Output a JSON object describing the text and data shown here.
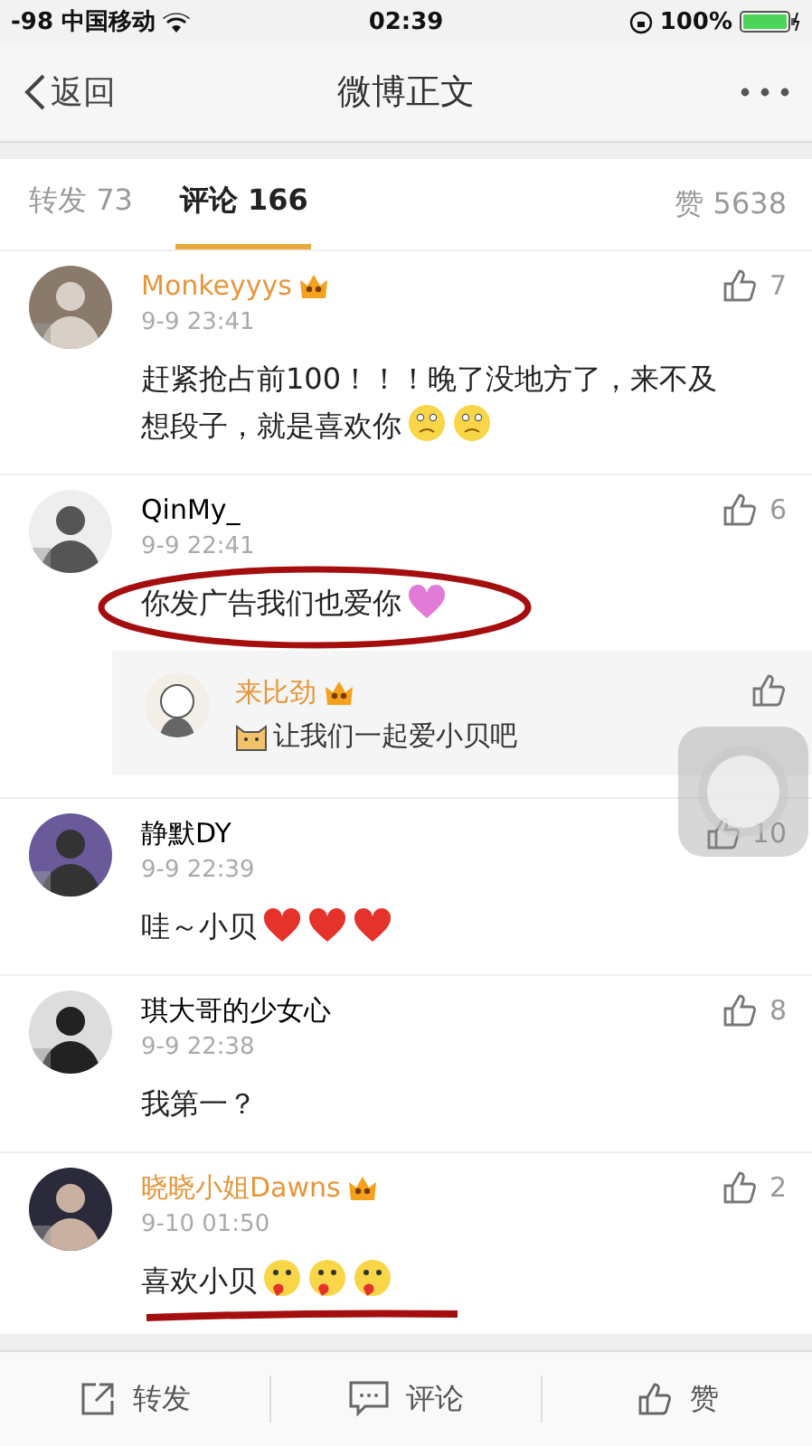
{
  "status_bar": {
    "carrier": "-98 中国移动",
    "time": "02:39",
    "battery": "100%"
  },
  "nav": {
    "back": "返回",
    "title": "微博正文"
  },
  "tabs": [
    {
      "label": "转发 73",
      "selected": false
    },
    {
      "label": "评论 166",
      "selected": true
    }
  ],
  "likes_tab": "赞 5638",
  "comments": [
    {
      "name": "Monkeyyys",
      "vip": true,
      "time": "9-9 23:41",
      "likes": "7",
      "text": "赶紧抢占前100！！！晚了没地方了，来不及想段子，就是喜欢你",
      "emojis": [
        {
          "kind": "sad"
        },
        {
          "kind": "sad"
        }
      ],
      "circled": false,
      "underlined": false
    },
    {
      "name": "QinMy_",
      "vip": false,
      "time": "9-9 22:41",
      "likes": "6",
      "text": "你发广告我们也爱你",
      "emojis": [
        {
          "kind": "pink-heart"
        }
      ],
      "circled": true,
      "underlined": false,
      "replies": [
        {
          "name": "来比劲",
          "vip": true,
          "text": "让我们一起爱小贝吧"
        }
      ]
    },
    {
      "name": "静默DY",
      "vip": false,
      "time": "9-9 22:39",
      "likes": "10",
      "text": "哇～小贝",
      "emojis": [
        {
          "kind": "heart"
        },
        {
          "kind": "heart"
        },
        {
          "kind": "heart"
        }
      ],
      "circled": false,
      "underlined": false
    },
    {
      "name": "琪大哥的少女心",
      "vip": false,
      "time": "9-9 22:38",
      "likes": "8",
      "text": "我第一？",
      "circled": false,
      "underlined": false
    },
    {
      "name": "晓晓小姐Dawns",
      "vip": true,
      "time": "9-10 01:50",
      "likes": "2",
      "text": "喜欢小贝",
      "emojis": [
        {
          "kind": "kiss"
        },
        {
          "kind": "kiss"
        },
        {
          "kind": "kiss"
        }
      ],
      "circled": false,
      "underlined": true
    }
  ],
  "bottom_bar": [
    {
      "kind": "share",
      "label": "转发"
    },
    {
      "kind": "comment",
      "label": "评论"
    },
    {
      "kind": "like",
      "label": "赞"
    }
  ]
}
